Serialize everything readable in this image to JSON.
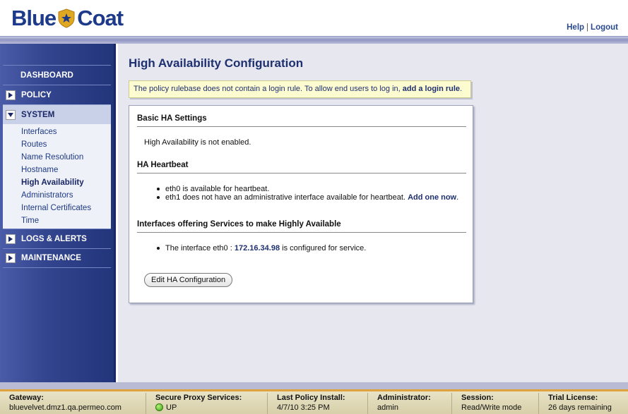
{
  "header": {
    "logo_text_left": "Blue",
    "logo_text_right": "Coat",
    "help_label": "Help",
    "separator": "|",
    "logout_label": "Logout"
  },
  "sidebar": {
    "dashboard": "DASHBOARD",
    "policy": "POLICY",
    "system": "SYSTEM",
    "system_items": [
      "Interfaces",
      "Routes",
      "Name Resolution",
      "Hostname",
      "High Availability",
      "Administrators",
      "Internal Certificates",
      "Time"
    ],
    "active_item": "High Availability",
    "logs_alerts": "LOGS & ALERTS",
    "maintenance": "MAINTENANCE"
  },
  "main": {
    "title": "High Availability Configuration",
    "notice_text": "The policy rulebase does not contain a login rule. To allow end users to log in,",
    "notice_link": "add a login rule",
    "notice_suffix": ".",
    "basic_title": "Basic HA Settings",
    "basic_text": "High Availability is not enabled.",
    "heartbeat_title": "HA Heartbeat",
    "heartbeat_item1": "eth0 is available for heartbeat.",
    "heartbeat_item2": "eth1 does not have an administrative interface available for heartbeat.",
    "heartbeat_link": "Add one now",
    "heartbeat_link_suffix": ".",
    "services_title": "Interfaces offering Services to make Highly Available",
    "service_prefix": "The interface eth0 :",
    "service_ip": "172.16.34.98",
    "service_suffix": "is configured for service.",
    "edit_button": "Edit HA Configuration"
  },
  "status": {
    "gateway_label": "Gateway:",
    "gateway_value": "bluevelvet.dmz1.qa.permeo.com",
    "proxy_label": "Secure Proxy Services:",
    "proxy_value": "UP",
    "proxy_color": "#3a9d12",
    "policy_label": "Last Policy Install:",
    "policy_value": "4/7/10 3:25 PM",
    "admin_label": "Administrator:",
    "admin_value": "admin",
    "session_label": "Session:",
    "session_value": "Read/Write mode",
    "trial_label": "Trial License:",
    "trial_value": "26 days remaining"
  },
  "colors": {
    "brand_blue": "#1d3a8a",
    "badge_gold": "#e0a821",
    "sidebar_blue": "#33458e",
    "accent_orange": "#e0a23a"
  }
}
